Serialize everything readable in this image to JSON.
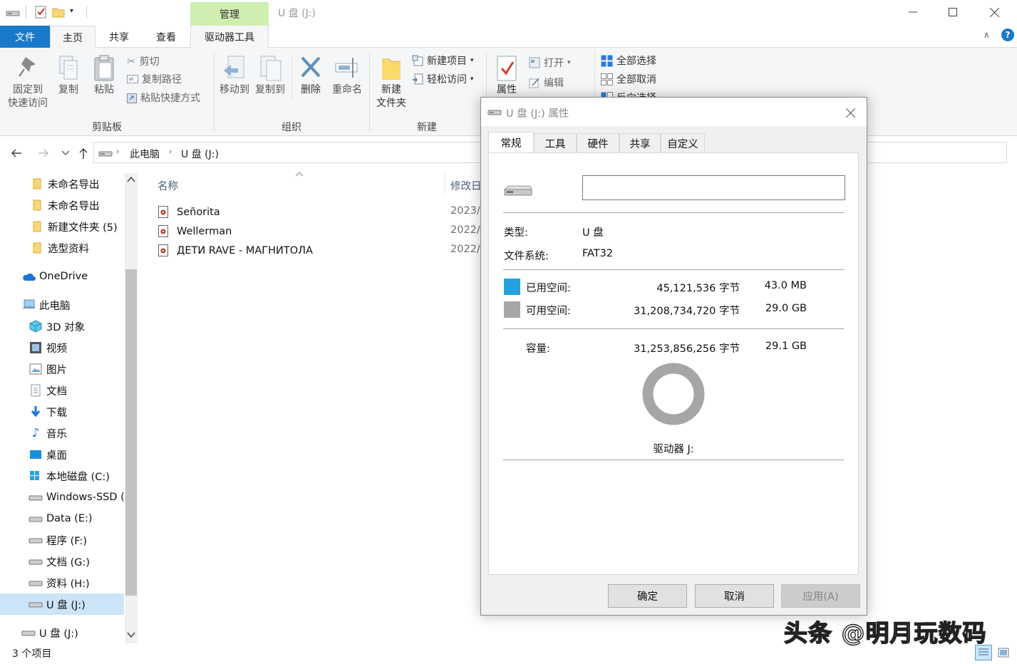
{
  "window": {
    "title": "U 盘 (J:)",
    "context_tab_group": "管理"
  },
  "ribbon_tabs": [
    "文件",
    "主页",
    "共享",
    "查看",
    "驱动器工具"
  ],
  "ribbon": {
    "clipboard": {
      "pin_line1": "固定到",
      "pin_line2": "快速访问",
      "copy": "复制",
      "paste": "粘贴",
      "cut": "剪切",
      "copy_path": "复制路径",
      "paste_shortcut": "粘贴快捷方式",
      "group": "剪贴板"
    },
    "organize": {
      "move_to": "移动到",
      "copy_to": "复制到",
      "delete": "删除",
      "rename": "重命名",
      "group": "组织"
    },
    "new": {
      "new_folder_line1": "新建",
      "new_folder_line2": "文件夹",
      "new_item": "新建项目",
      "easy_access": "轻松访问",
      "group": "新建"
    },
    "open": {
      "properties": "属性",
      "open": "打开",
      "edit": "编辑"
    },
    "select": {
      "select_all": "全部选择",
      "select_none": "全部取消",
      "invert": "反向选择"
    }
  },
  "address": {
    "crumbs": [
      "此电脑",
      "U 盘 (J:)"
    ]
  },
  "nav": {
    "items": [
      "未命名导出",
      "未命名导出",
      "新建文件夹 (5)",
      "选型资料",
      "OneDrive",
      "此电脑",
      "3D 对象",
      "视频",
      "图片",
      "文档",
      "下载",
      "音乐",
      "桌面",
      "本地磁盘 (C:)",
      "Windows-SSD (",
      "Data (E:)",
      "程序 (F:)",
      "文档 (G:)",
      "资料 (H:)",
      "U 盘 (J:)",
      "U 盘 (J:)"
    ]
  },
  "file_list": {
    "col_name": "名称",
    "col_date": "修改日",
    "rows": [
      {
        "name": "Señorita",
        "date": "2023/"
      },
      {
        "name": "Wellerman",
        "date": "2022/"
      },
      {
        "name": "ДЕТИ RAVE - МАГНИТОЛА",
        "date": "2022/"
      }
    ]
  },
  "status": {
    "count": "3 个项目"
  },
  "dialog": {
    "title": "U 盘 (J:) 属性",
    "tabs": [
      "常规",
      "工具",
      "硬件",
      "共享",
      "自定义"
    ],
    "name_value": "",
    "type_label": "类型:",
    "type_value": "U 盘",
    "fs_label": "文件系统:",
    "fs_value": "FAT32",
    "used_label": "已用空间:",
    "used_bytes": "45,121,536 字节",
    "used_human": "43.0 MB",
    "free_label": "可用空间:",
    "free_bytes": "31,208,734,720 字节",
    "free_human": "29.0 GB",
    "cap_label": "容量:",
    "cap_bytes": "31,253,856,256 字节",
    "cap_human": "29.1 GB",
    "drive_label": "驱动器 J:",
    "used_fraction": 0.0014,
    "ok": "确定",
    "cancel": "取消",
    "apply": "应用(A)"
  },
  "colors": {
    "accent": "#1979ca",
    "context_tab": "#cfeeb0",
    "used": "#26a0da",
    "free": "#a6a6a6"
  },
  "watermark": "头条 @明月玩数码"
}
